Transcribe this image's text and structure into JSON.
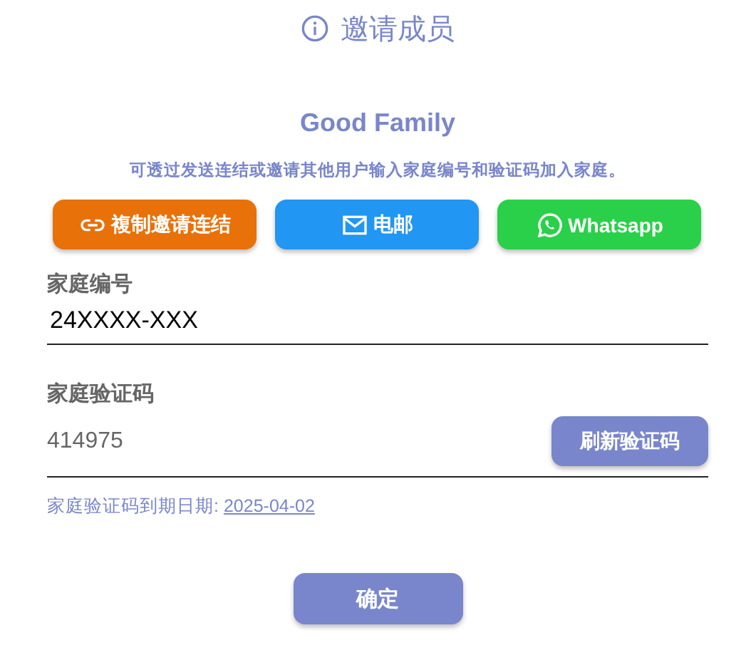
{
  "dialog": {
    "title": "邀请成员"
  },
  "family_name": "Good Family",
  "description": "可透过发送连结或邀请其他用户输入家庭编号和验证码加入家庭。",
  "share_buttons": [
    {
      "kind": "link",
      "label": "複制邀请连结",
      "color": "#e8710a"
    },
    {
      "kind": "email",
      "label": "电邮",
      "color": "#2196f3"
    },
    {
      "kind": "whatsapp",
      "label": "Whatsapp",
      "color": "#2ad04a"
    }
  ],
  "family_id": {
    "label": "家庭编号",
    "value": "24XXXX-XXX"
  },
  "verification_code": {
    "label": "家庭验证码",
    "value": "414975",
    "disabled": true,
    "refresh_button": "刷新验证码"
  },
  "expiry": {
    "label": "家庭验证码到期日期:",
    "date": "2025-04-02"
  },
  "confirm_button": "确定"
}
